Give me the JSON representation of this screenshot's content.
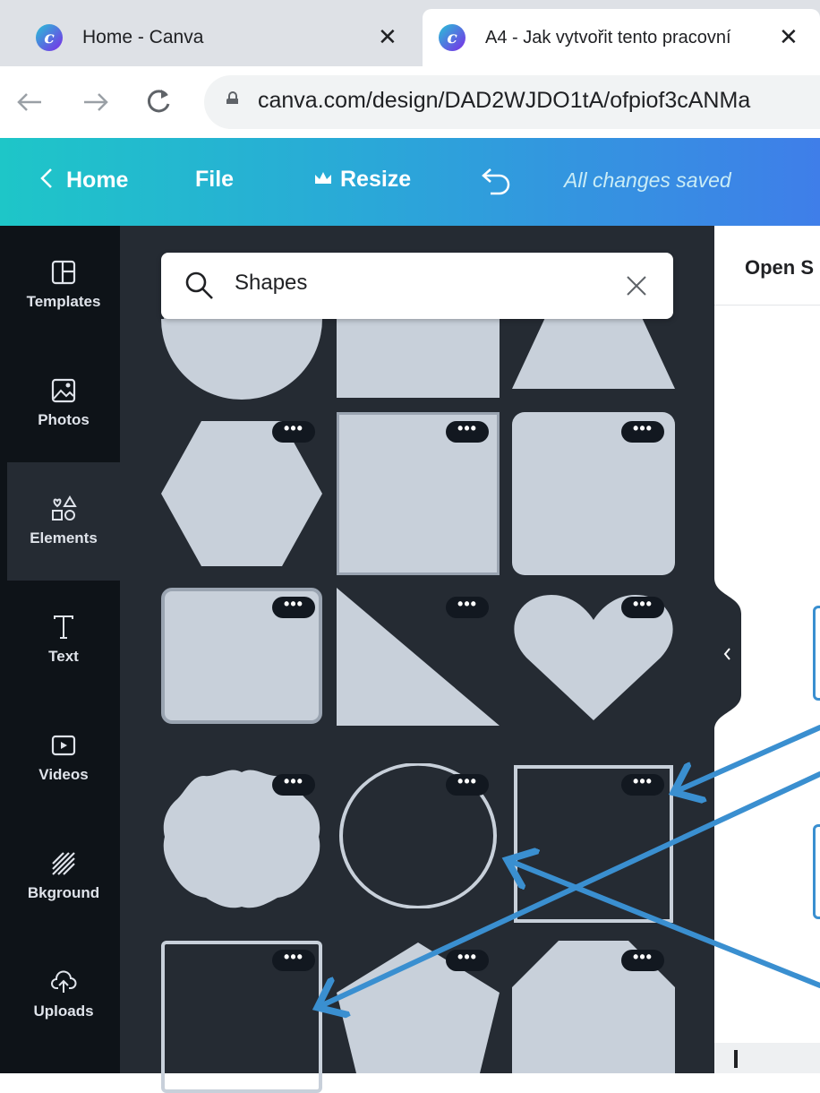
{
  "browser": {
    "tabs": [
      {
        "title": "Home - Canva",
        "close": "✕"
      },
      {
        "title": "A4 - Jak vytvořit tento pracovní",
        "close": "✕"
      }
    ],
    "favicon_letter": "c",
    "url": "canva.com/design/DAD2WJDO1tA/ofpiof3cANMa"
  },
  "header": {
    "home": "Home",
    "file": "File",
    "resize": "Resize",
    "status": "All changes saved"
  },
  "sidebar": {
    "items": [
      {
        "label": "Templates",
        "icon": "templates-icon"
      },
      {
        "label": "Photos",
        "icon": "photos-icon"
      },
      {
        "label": "Elements",
        "icon": "elements-icon"
      },
      {
        "label": "Text",
        "icon": "text-icon"
      },
      {
        "label": "Videos",
        "icon": "videos-icon"
      },
      {
        "label": "Bkground",
        "icon": "background-icon"
      },
      {
        "label": "Uploads",
        "icon": "uploads-icon"
      }
    ]
  },
  "panel": {
    "search_value": "Shapes",
    "more_label": "•••"
  },
  "canvas": {
    "open_label": "Open S"
  },
  "colors": {
    "shape_fill": "#c8d0da",
    "panel_bg": "#252b33",
    "arrow": "#3a8fd0"
  }
}
